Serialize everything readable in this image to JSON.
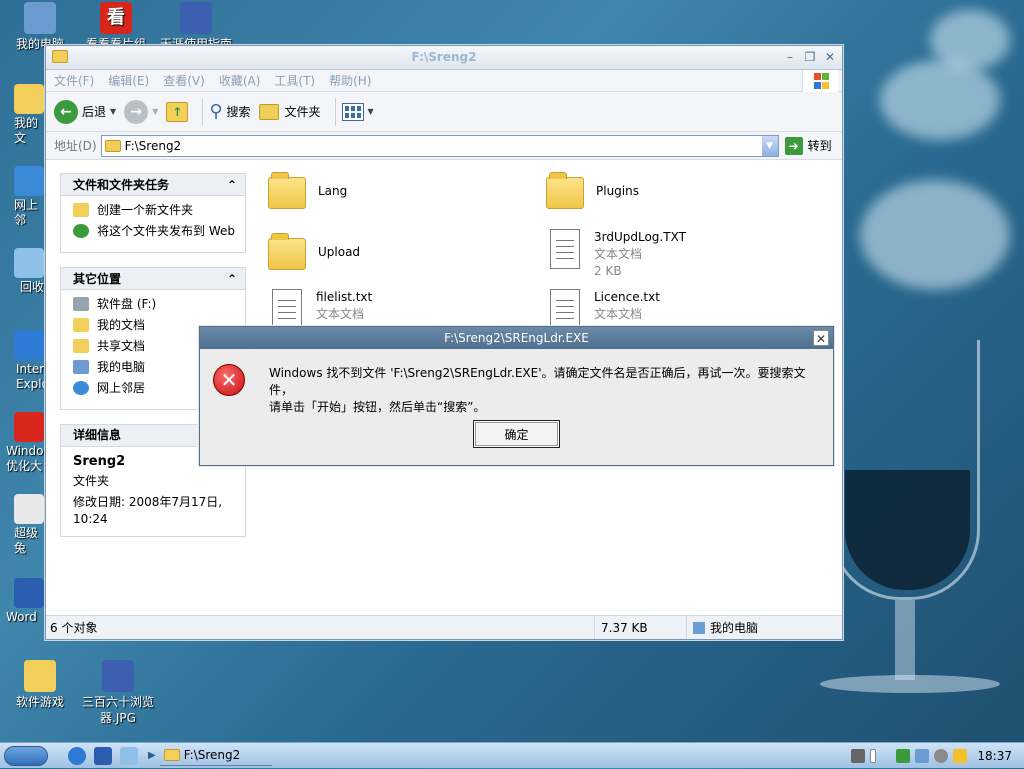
{
  "desktop": {
    "icons": [
      {
        "label": "我的电脑",
        "color": "#6c9bd1"
      },
      {
        "label": "看看看片组",
        "color": "#d9261c"
      },
      {
        "label": "天涯使用指南",
        "color": "#3c5fb0"
      }
    ],
    "clipped": [
      {
        "label": "我的文",
        "color": "#f2cf5b"
      },
      {
        "label": "网上邻",
        "color": "#3b8ad8"
      },
      {
        "label": "回收",
        "color": "#8ec0e8"
      },
      {
        "label": "Inter Explo",
        "color": "#2e7bd6"
      },
      {
        "label": "Windo 优化大",
        "color": "#d9261c"
      },
      {
        "label": "超级兔",
        "color": "#e8e8e8"
      },
      {
        "label": "Word",
        "color": "#2a5db0"
      }
    ],
    "bottom_icons": [
      {
        "label": "软件游戏",
        "color": "#f2cf5b"
      },
      {
        "label": "三百六十浏览器.JPG",
        "color": "#3c5fb0"
      }
    ]
  },
  "window": {
    "title": "F:\\Sreng2",
    "menus": [
      "文件(F)",
      "编辑(E)",
      "查看(V)",
      "收藏(A)",
      "工具(T)",
      "帮助(H)"
    ],
    "toolbar": {
      "back": "后退",
      "search": "搜索",
      "folders": "文件夹"
    },
    "address": {
      "label": "地址(D)",
      "value": "F:\\Sreng2",
      "go": "转到"
    }
  },
  "tasks_panel": {
    "title": "文件和文件夹任务",
    "items": [
      {
        "label": "创建一个新文件夹",
        "color": "#f2cf5b"
      },
      {
        "label": "将这个文件夹发布到 Web",
        "color": "#3b9a3b"
      }
    ]
  },
  "places_panel": {
    "title": "其它位置",
    "items": [
      {
        "label": "软件盘 (F:)",
        "color": "#9aa4ae"
      },
      {
        "label": "我的文档",
        "color": "#f2cf5b"
      },
      {
        "label": "共享文档",
        "color": "#f2cf5b"
      },
      {
        "label": "我的电脑",
        "color": "#6c9bd1"
      },
      {
        "label": "网上邻居",
        "color": "#3b8ad8"
      }
    ]
  },
  "details_panel": {
    "title": "详细信息",
    "name": "Sreng2",
    "type": "文件夹",
    "modified": "修改日期: 2008年7月17日, 10:24"
  },
  "files": [
    {
      "name": "Lang",
      "kind": "folder"
    },
    {
      "name": "Plugins",
      "kind": "folder"
    },
    {
      "name": "Upload",
      "kind": "folder"
    },
    {
      "name": "3rdUpdLog.TXT",
      "kind": "doc",
      "type": "文本文档",
      "size": "2 KB"
    },
    {
      "name": "filelist.txt",
      "kind": "doc",
      "type": "文本文档"
    },
    {
      "name": "Licence.txt",
      "kind": "doc",
      "type": "文本文档"
    }
  ],
  "status": {
    "count": "6 个对象",
    "size": "7.37 KB",
    "location": "我的电脑"
  },
  "dialog": {
    "title": "F:\\Sreng2\\SREngLdr.EXE",
    "line1": "Windows 找不到文件 'F:\\Sreng2\\SREngLdr.EXE'。请确定文件名是否正确后，再试一次。要搜索文件，",
    "line2": "请单击「开始」按钮，然后单击“搜索”。",
    "ok": "确定"
  },
  "taskbar": {
    "window_button": "F:\\Sreng2",
    "clock": "18:37"
  }
}
